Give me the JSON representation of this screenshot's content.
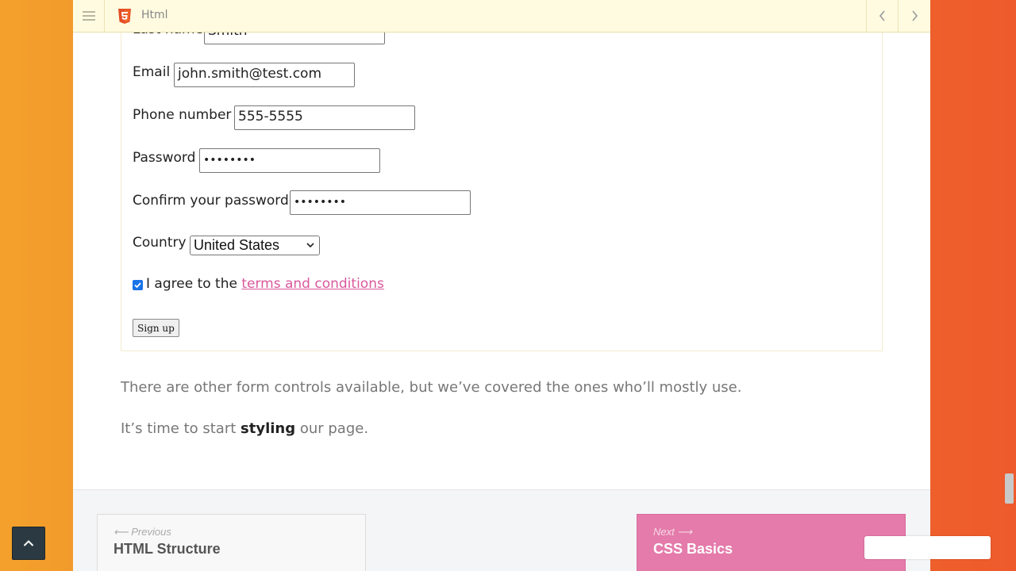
{
  "topbar": {
    "title": "Html"
  },
  "form": {
    "last_name": {
      "label": "Last name",
      "value": "Smith"
    },
    "email": {
      "label": "Email",
      "value": "john.smith@test.com"
    },
    "phone": {
      "label": "Phone number",
      "value": "555-5555"
    },
    "password": {
      "label": "Password",
      "value": "••••••••"
    },
    "confirm_password": {
      "label": "Confirm your password",
      "value": "••••••••"
    },
    "country": {
      "label": "Country",
      "selected": "United States"
    },
    "agree": {
      "text": "I agree to the ",
      "link": "terms and conditions",
      "checked": true
    },
    "submit_label": "Sign up"
  },
  "content": {
    "para1": "There are other form controls available, but we’ve covered the ones who’ll mostly use.",
    "para2_before": "It’s time to start ",
    "para2_bold": "styling",
    "para2_after": " our page."
  },
  "nav": {
    "prev": {
      "hint": "⟵ Previous",
      "title": "HTML Structure"
    },
    "next": {
      "hint": "Next ⟶",
      "title": "CSS Basics"
    }
  },
  "colors": {
    "accent": "#e47baa",
    "link": "#d9589c",
    "topbar": "#fefbe0"
  }
}
